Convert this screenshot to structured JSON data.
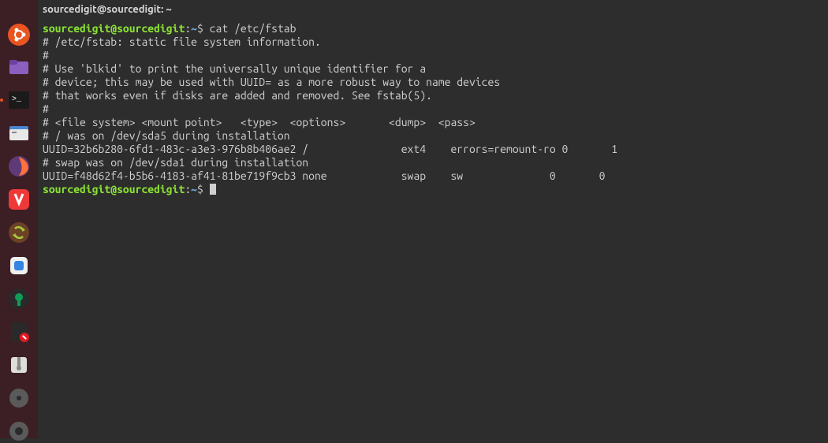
{
  "titlebar": "sourcedigit@sourcedigit: ~",
  "prompt": {
    "user": "sourcedigit@sourcedigit",
    "path": "~",
    "symbol": "$"
  },
  "command": "cat /etc/fstab",
  "output_lines": [
    "# /etc/fstab: static file system information.",
    "#",
    "# Use 'blkid' to print the universally unique identifier for a",
    "# device; this may be used with UUID= as a more robust way to name devices",
    "# that works even if disks are added and removed. See fstab(5).",
    "#",
    "# <file system> <mount point>   <type>  <options>       <dump>  <pass>",
    "# / was on /dev/sda5 during installation",
    "UUID=32b6b280-6fd1-483c-a3e3-976b8b406ae2 /               ext4    errors=remount-ro 0       1",
    "# swap was on /dev/sda1 during installation",
    "UUID=f48d62f4-b5b6-4183-af41-81be719f9cb3 none            swap    sw              0       0"
  ],
  "dock": {
    "items": [
      {
        "name": "ubuntu",
        "color": "#e95420"
      },
      {
        "name": "files",
        "color": "#6c3fa0"
      },
      {
        "name": "terminal",
        "color": "#2c2c2c"
      },
      {
        "name": "nautilus",
        "color": "#3c7ab5"
      },
      {
        "name": "firefox",
        "color": "#ff7139"
      },
      {
        "name": "vivaldi",
        "color": "#ef3939"
      },
      {
        "name": "sync",
        "color": "#5e8d2a"
      },
      {
        "name": "app1",
        "color": "#e8e8e8"
      },
      {
        "name": "settings",
        "color": "#333333"
      },
      {
        "name": "text-editor",
        "color": "#2c2c2c"
      },
      {
        "name": "archive",
        "color": "#e8e8e8"
      },
      {
        "name": "disks",
        "color": "#5a5a5a"
      },
      {
        "name": "app2",
        "color": "#5a5a5a"
      }
    ]
  }
}
